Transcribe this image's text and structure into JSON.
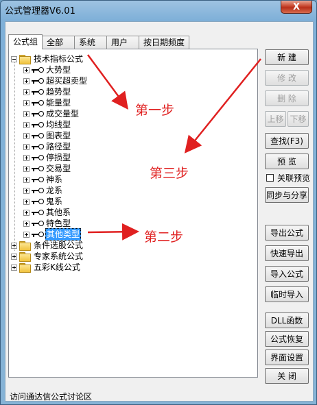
{
  "window": {
    "title": "公式管理器V6.01",
    "close_label": "X"
  },
  "tabs": [
    {
      "label": "公式组",
      "active": true
    },
    {
      "label": "全部",
      "active": false
    },
    {
      "label": "系统",
      "active": false
    },
    {
      "label": "用户",
      "active": false
    },
    {
      "label": "按日期频度",
      "active": false
    }
  ],
  "tree": {
    "root": "技术指标公式",
    "children": [
      "大势型",
      "超买超卖型",
      "趋势型",
      "能量型",
      "成交量型",
      "均线型",
      "图表型",
      "路径型",
      "停损型",
      "交易型",
      "神系",
      "龙系",
      "鬼系",
      "其他系",
      "特色型",
      "其他类型"
    ],
    "selected": "其他类型",
    "others": [
      "条件选股公式",
      "专家系统公式",
      "五彩K线公式"
    ]
  },
  "buttons": {
    "new": "新  建",
    "edit": "修  改",
    "delete": "删  除",
    "move_up": "上移",
    "move_down": "下移",
    "find": "查找(F3)",
    "preview": "预  览",
    "link_preview": "关联预览",
    "sync_share": "同步与分享",
    "export": "导出公式",
    "quick_export": "快速导出",
    "import": "导入公式",
    "temp_import": "临时导入",
    "dll": "DLL函数",
    "restore": "公式恢复",
    "ui_settings": "界面设置",
    "close": "关  闭"
  },
  "status": {
    "text": "访问通达信公式讨论区"
  },
  "annotations": {
    "step1": "第一步",
    "step2": "第二步",
    "step3": "第三步",
    "color": "#e02020"
  }
}
